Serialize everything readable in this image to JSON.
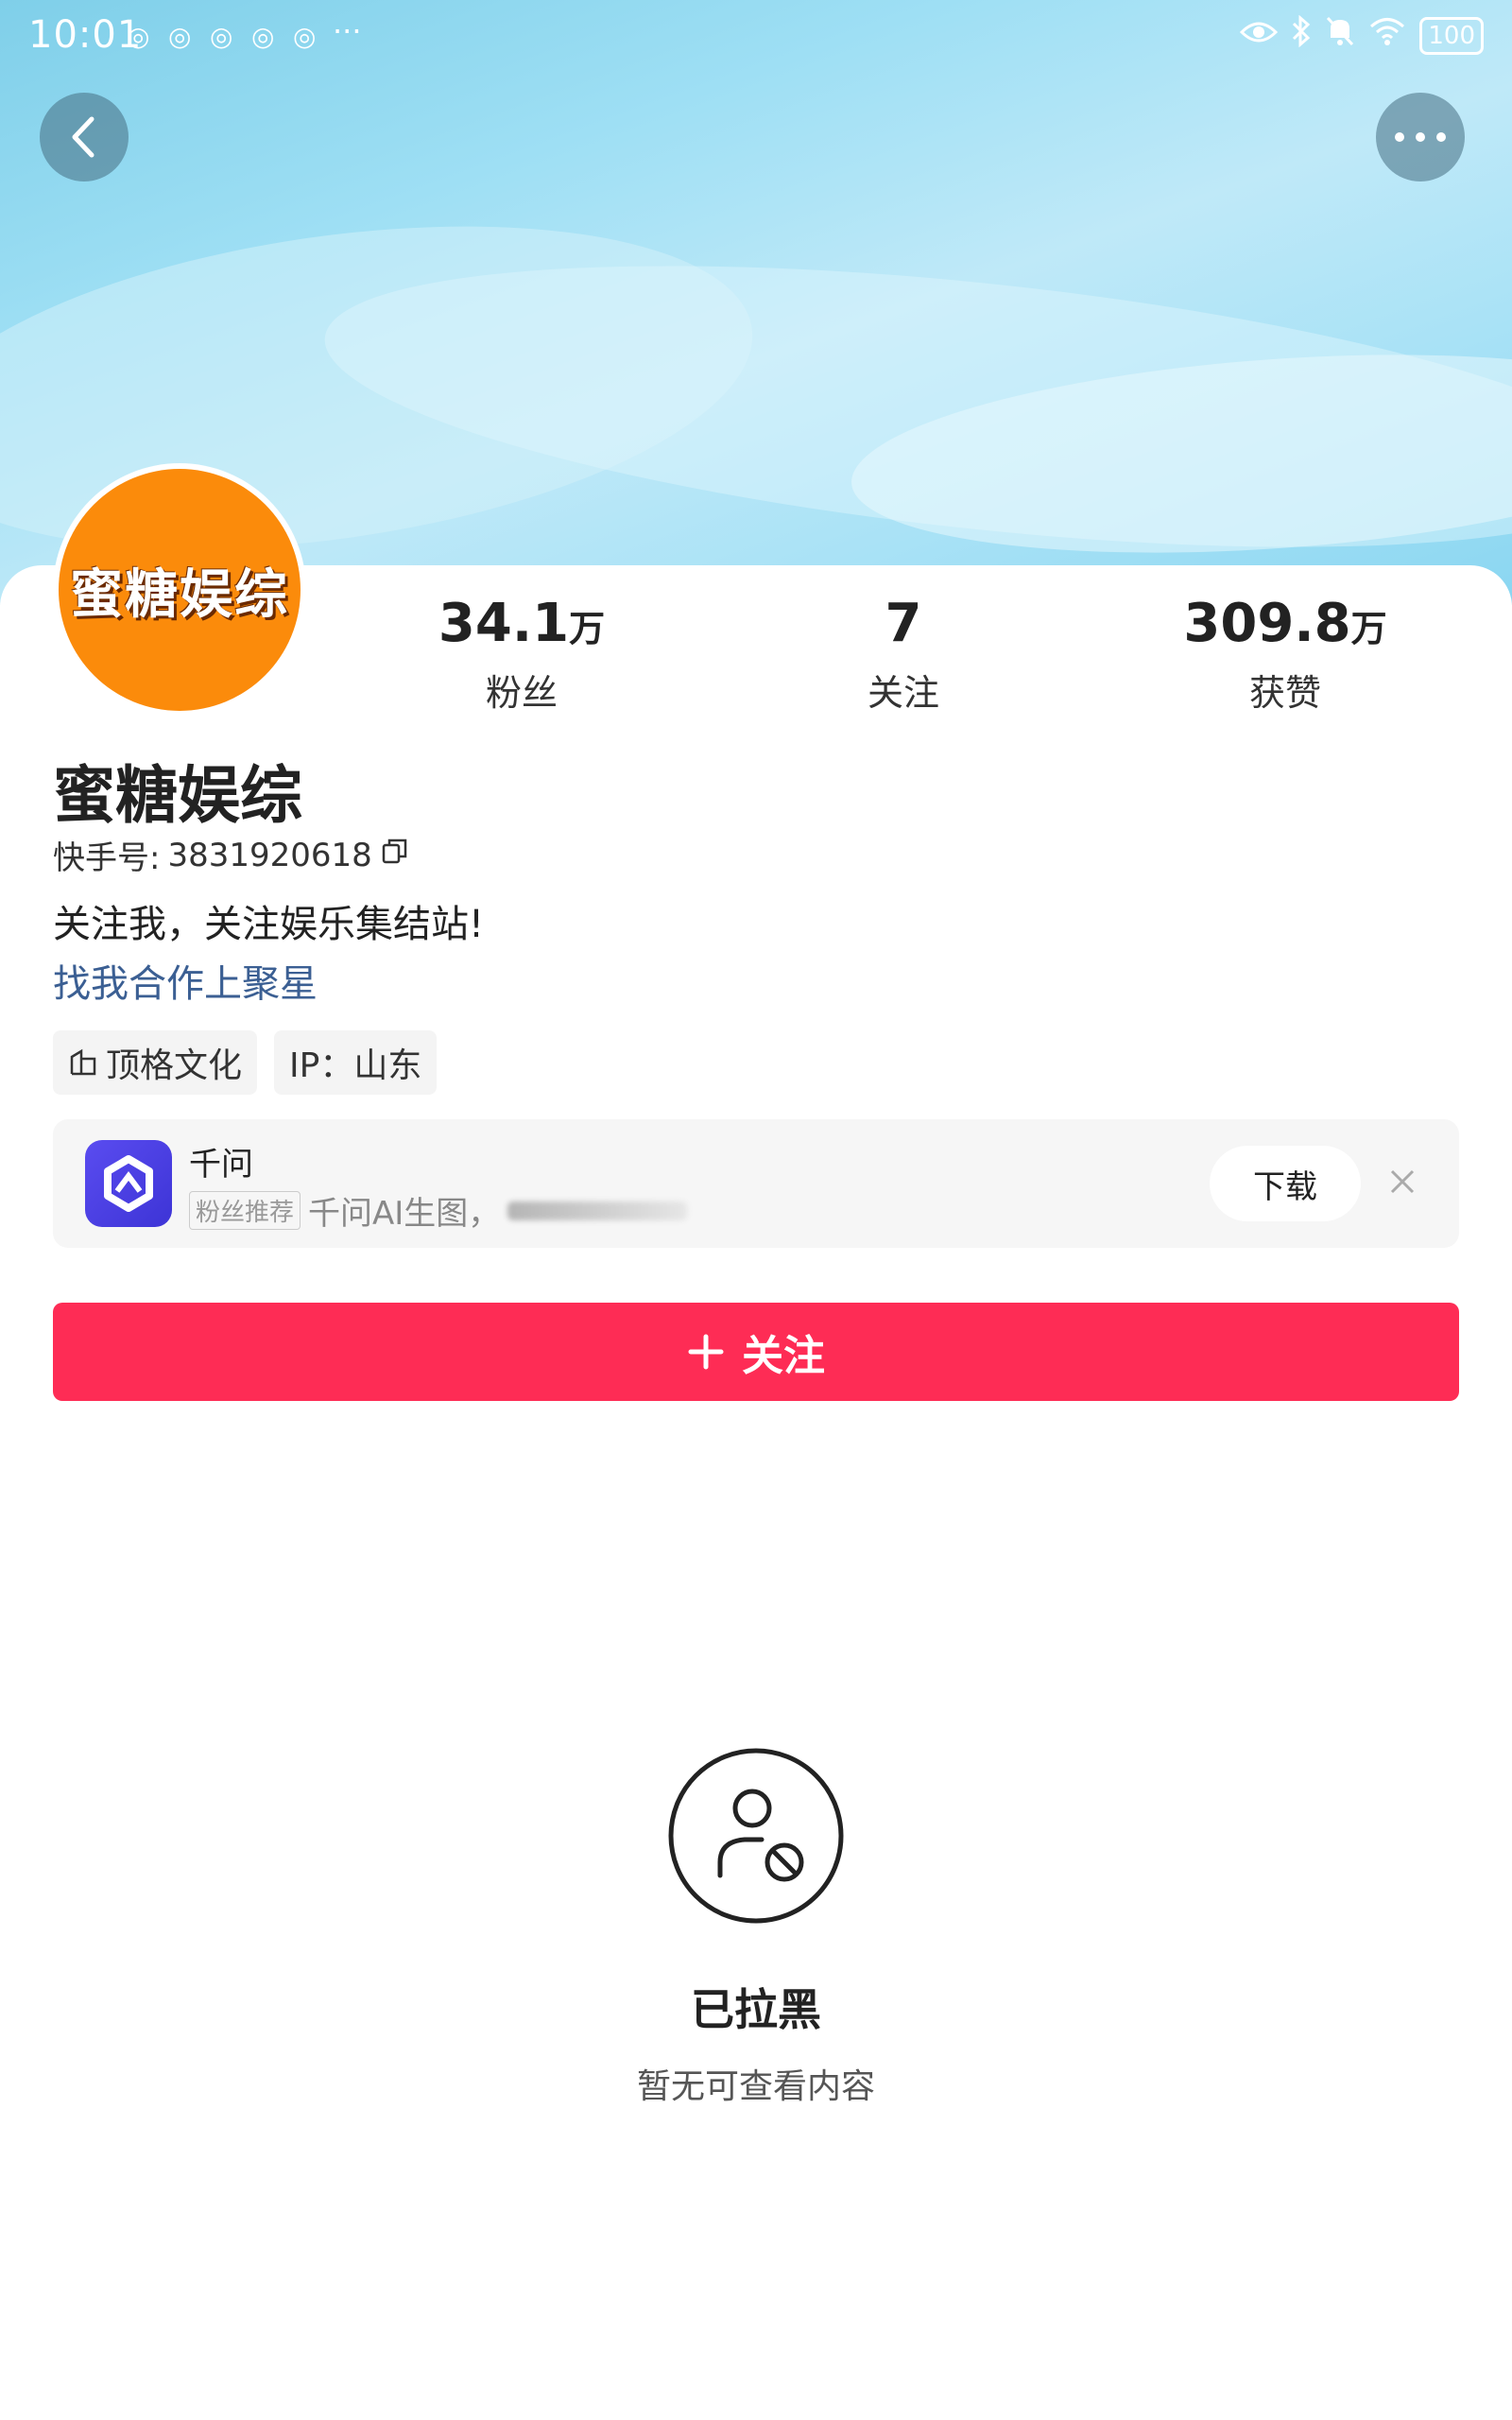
{
  "status_bar": {
    "time": "10:01",
    "more": "···",
    "battery": "100"
  },
  "profile": {
    "avatar_text": "蜜糖娱综",
    "name": "蜜糖娱综",
    "kuaishou_id_label": "快手号:",
    "kuaishou_id": "3831920618",
    "bio": "关注我，关注娱乐集结站!",
    "link_text": "找我合作上聚星"
  },
  "stats": [
    {
      "number": "34.1",
      "unit": "万",
      "label": "粉丝"
    },
    {
      "number": "7",
      "unit": "",
      "label": "关注"
    },
    {
      "number": "309.8",
      "unit": "万",
      "label": "获赞"
    }
  ],
  "tags": {
    "company": "顶格文化",
    "ip": "IP：山东"
  },
  "ad": {
    "app_name": "千问",
    "badge": "粉丝推荐",
    "description": "千问AI生图，",
    "download_label": "下载"
  },
  "follow_button": {
    "label": "关注"
  },
  "blocked": {
    "title": "已拉黑",
    "subtitle": "暂无可查看内容"
  },
  "colors": {
    "accent": "#fe2c55",
    "link": "#3b5f93",
    "avatar_bg": "#fb8b0b",
    "ad_logo": "#4a3fe3"
  }
}
